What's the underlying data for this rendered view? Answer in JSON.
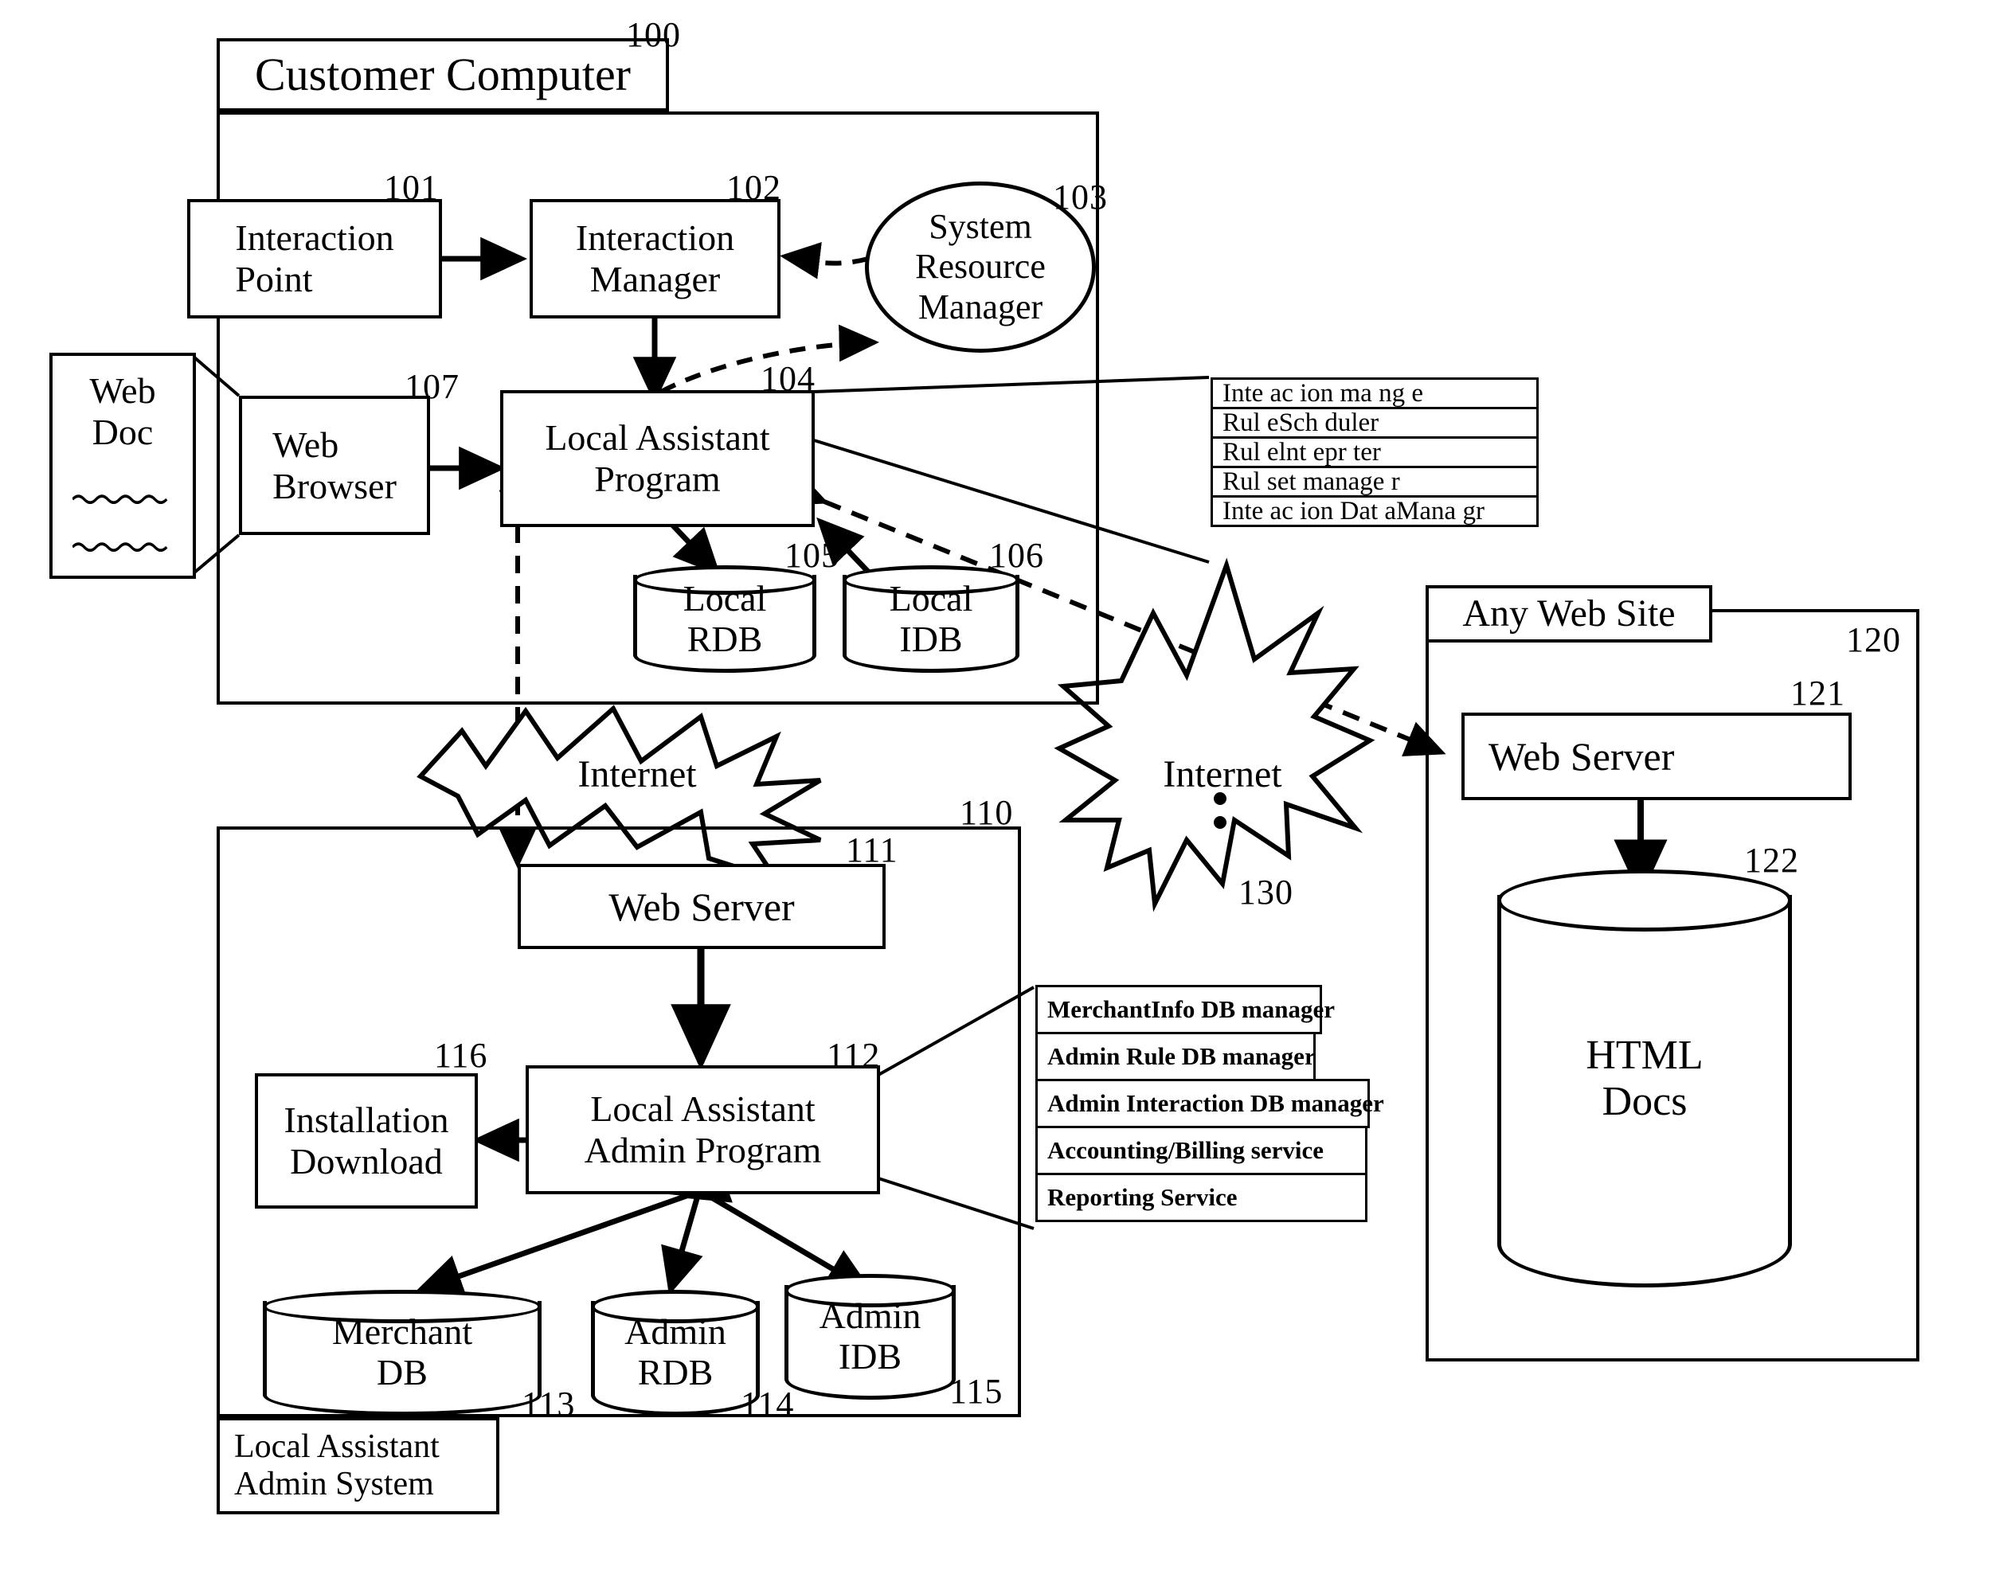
{
  "figure": {
    "customer_computer": {
      "title": "Customer Computer",
      "ref": "100",
      "interaction_point": {
        "label": "Interaction\nPoint",
        "line1": "Interaction",
        "line2": "Point",
        "ref": "101"
      },
      "interaction_manager": {
        "line1": "Interaction",
        "line2": "Manager",
        "ref": "102"
      },
      "system_resource_manager": {
        "line1": "System",
        "line2": "Resource",
        "line3": "Manager",
        "ref": "103"
      },
      "web_browser": {
        "line1": "Web",
        "line2": "Browser",
        "ref": "107"
      },
      "local_assistant_program": {
        "line1": "Local Assistant",
        "line2": "Program",
        "ref": "104"
      },
      "local_rdb": {
        "line1": "Local",
        "line2": "RDB",
        "ref": "105"
      },
      "local_idb": {
        "line1": "Local",
        "line2": "IDB",
        "ref": "106"
      }
    },
    "web_doc": {
      "line1": "Web",
      "line2": "Doc"
    },
    "local_assistant_program_modules": [
      "Inte ac ion ma  ng  e",
      "Rul eSch  duler",
      "Rul elnt  epr  ter",
      "Rul  set manage r",
      "Inte ac ion Dat aMana gr"
    ],
    "internet_left": {
      "label": "Internet"
    },
    "internet_right": {
      "label": "Internet",
      "ref": "130"
    },
    "admin_system": {
      "ref": "110",
      "caption_line1": "Local Assistant",
      "caption_line2": "Admin System",
      "web_server": {
        "label": "Web Server",
        "ref": "111"
      },
      "installation_download": {
        "line1": "Installation",
        "line2": "Download",
        "ref": "116"
      },
      "local_assistant_admin_program": {
        "line1": "Local Assistant",
        "line2": "Admin Program",
        "ref": "112"
      },
      "merchant_db": {
        "line1": "Merchant",
        "line2": "DB",
        "ref": "113"
      },
      "admin_rdb": {
        "line1": "Admin",
        "line2": "RDB",
        "ref": "114"
      },
      "admin_idb": {
        "line1": "Admin",
        "line2": "IDB",
        "ref": "115"
      }
    },
    "admin_program_modules": [
      "MerchantInfo DB manager",
      "Admin Rule DB manager",
      "Admin Interaction DB manager",
      "Accounting/Billing service",
      "Reporting Service"
    ],
    "any_web_site": {
      "title": "Any Web Site",
      "ref": "120",
      "web_server": {
        "label": "Web Server",
        "ref": "121"
      },
      "html_docs": {
        "line1": "HTML",
        "line2": "Docs",
        "ref": "122"
      }
    }
  },
  "colors": {
    "ink": "#000000",
    "paper": "#ffffff"
  }
}
